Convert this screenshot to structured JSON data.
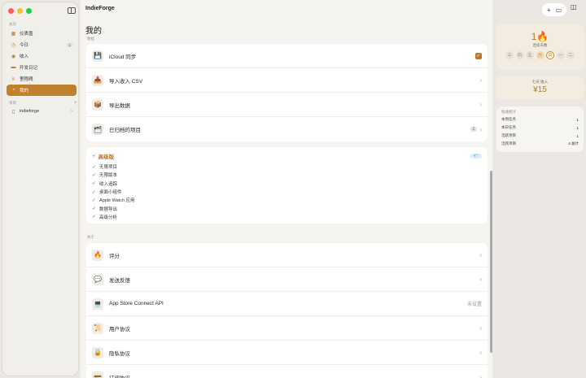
{
  "sidebar": {
    "section_overview": "总览",
    "items": [
      {
        "label": "仪表盘",
        "icon": "dashboard-icon",
        "glyph": "▦",
        "count": ""
      },
      {
        "label": "今日",
        "icon": "clock-icon",
        "glyph": "◷",
        "count": "1"
      },
      {
        "label": "收入",
        "icon": "income-icon",
        "glyph": "◉",
        "count": ""
      },
      {
        "label": "开发日记",
        "icon": "book-icon",
        "glyph": "▬",
        "count": ""
      },
      {
        "label": "里程碑",
        "icon": "trophy-icon",
        "glyph": "♕",
        "count": ""
      },
      {
        "label": "我的",
        "icon": "person-icon",
        "glyph": "◔",
        "count": ""
      }
    ],
    "section_projects": "项目",
    "add_glyph": "+",
    "projects": [
      {
        "label": "indieforge",
        "icon": "project-icon",
        "glyph": "▯"
      }
    ]
  },
  "main": {
    "app_title": "IndieForge",
    "page_title": "我的",
    "section_data": "数据",
    "data_rows": [
      {
        "label": "iCloud 同步",
        "icon": "save-icon",
        "glyph": "💾",
        "right": "checkbox",
        "checked": true
      },
      {
        "label": "导入收入 CSV",
        "icon": "import-icon",
        "glyph": "📥",
        "right": "chevron"
      },
      {
        "label": "导出数据",
        "icon": "box-icon",
        "glyph": "📦",
        "right": "chevron"
      },
      {
        "label": "已归档的项目",
        "icon": "archive-icon",
        "glyph": "🗂",
        "right": "badge",
        "badge": "1"
      }
    ],
    "premium": {
      "title": "高级版",
      "badge": "💎",
      "features": [
        "无限项目",
        "无限版本",
        "收入追踪",
        "桌面小组件",
        "Apple Watch 应用",
        "数据导出",
        "高级分析"
      ]
    },
    "section_about": "关于",
    "about_rows": [
      {
        "label": "评分",
        "icon": "fire-icon",
        "glyph": "🔥",
        "right_text": ""
      },
      {
        "label": "发送反馈",
        "icon": "chat-icon",
        "glyph": "💬",
        "right_text": ""
      },
      {
        "label": "App Store Connect API",
        "icon": "laptop-icon",
        "glyph": "💻",
        "right_text": "未设置"
      },
      {
        "label": "用户协议",
        "icon": "document-icon",
        "glyph": "📜",
        "right_text": ""
      },
      {
        "label": "隐私协议",
        "icon": "lock-icon",
        "glyph": "🔒",
        "right_text": ""
      },
      {
        "label": "订阅协议",
        "icon": "card-icon",
        "glyph": "💳",
        "right_text": ""
      }
    ]
  },
  "right_panel": {
    "streak": {
      "value": "1🔥",
      "label": "连续天数",
      "days": [
        {
          "label": "三",
          "state": "off"
        },
        {
          "label": "四",
          "state": "off"
        },
        {
          "label": "五",
          "state": "off"
        },
        {
          "label": "六",
          "state": "on"
        },
        {
          "label": "日",
          "state": "today"
        },
        {
          "label": "一",
          "state": "off"
        },
        {
          "label": "二",
          "state": "off"
        }
      ]
    },
    "income": {
      "label": "七天 收入",
      "value": "¥15"
    },
    "stats": {
      "title": "快速统计",
      "rows": [
        {
          "label": "本周任务",
          "value": "1"
        },
        {
          "label": "本日任务",
          "value": "1"
        },
        {
          "label": "活跃项目",
          "value": "1"
        },
        {
          "label": "活跃项目",
          "value": "4 总计"
        }
      ]
    }
  }
}
